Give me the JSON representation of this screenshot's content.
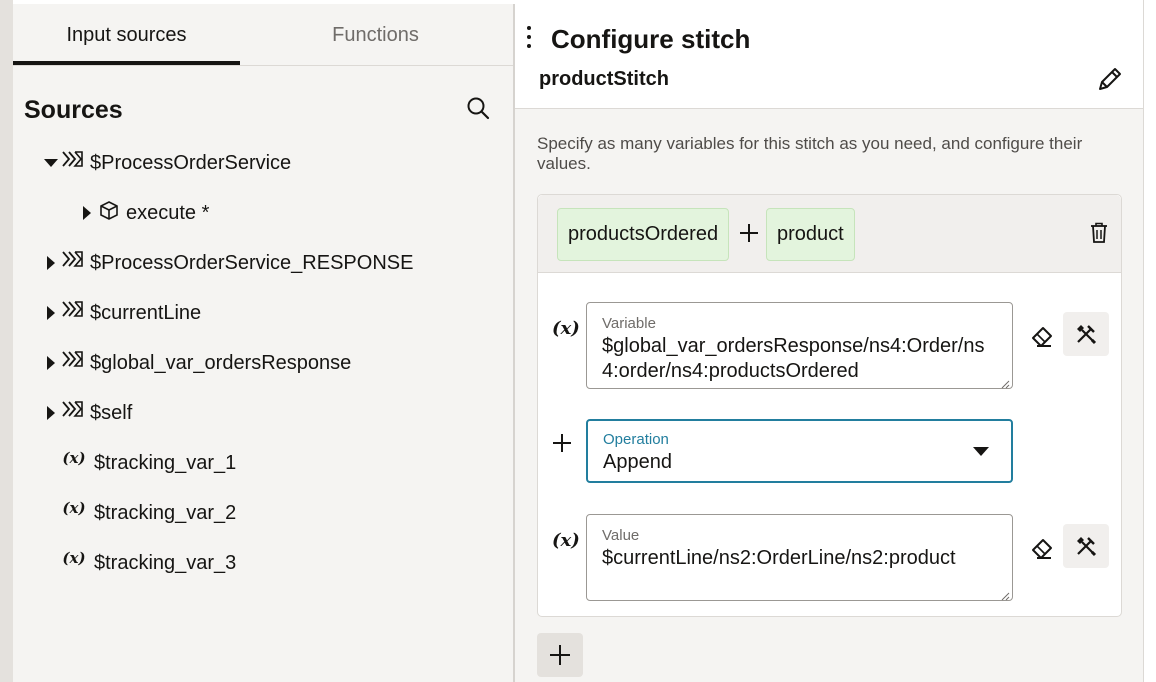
{
  "tabs": [
    {
      "label": "Input sources",
      "active": true
    },
    {
      "label": "Functions",
      "active": false
    }
  ],
  "sources": {
    "title": "Sources",
    "tree": [
      {
        "label": "$ProcessOrderService",
        "expanded": true,
        "icon": "data-source-icon"
      },
      {
        "label": "execute *",
        "expanded": false,
        "icon": "cube-icon"
      },
      {
        "label": "$ProcessOrderService_RESPONSE",
        "expanded": false,
        "icon": "data-source-icon"
      },
      {
        "label": "$currentLine",
        "expanded": false,
        "icon": "data-source-icon"
      },
      {
        "label": "$global_var_ordersResponse",
        "expanded": false,
        "icon": "data-source-icon"
      },
      {
        "label": "$self",
        "expanded": false,
        "icon": "data-source-icon"
      },
      {
        "label": "$tracking_var_1",
        "icon": "variable-icon"
      },
      {
        "label": "$tracking_var_2",
        "icon": "variable-icon"
      },
      {
        "label": "$tracking_var_3",
        "icon": "variable-icon"
      }
    ],
    "variable_glyph": "(x)"
  },
  "panel": {
    "title": "Configure stitch",
    "stitch_name": "productStitch",
    "help_text": "Specify as many variables for this stitch as you need, and configure their values.",
    "chips": [
      "productsOrdered",
      "product"
    ],
    "variable_field": {
      "label": "Variable",
      "value": "$global_var_ordersResponse/ns4:Order/ns4:order/ns4:productsOrdered"
    },
    "operation_field": {
      "label": "Operation",
      "value": "Append"
    },
    "value_field": {
      "label": "Value",
      "value": "$currentLine/ns2:OrderLine/ns2:product"
    },
    "x_glyph": "(x)",
    "plus_glyph": "+"
  },
  "colors": {
    "accent": "#227e9e",
    "chip_bg": "#e3f4dd",
    "panel_bg": "#f5f4f2"
  }
}
